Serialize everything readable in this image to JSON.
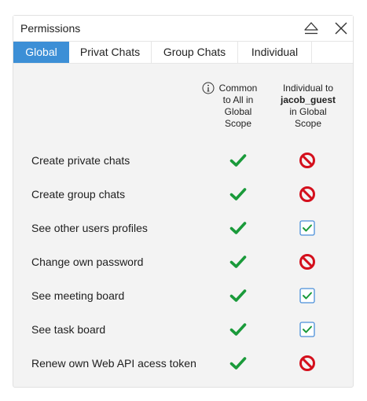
{
  "window": {
    "title": "Permissions"
  },
  "icons": {
    "eject": "eject-icon",
    "close": "close-icon",
    "info": "info-icon"
  },
  "tabs": [
    {
      "label": "Global",
      "active": true
    },
    {
      "label": "Privat Chats",
      "active": false
    },
    {
      "label": "Group Chats",
      "active": false
    },
    {
      "label": "Individual",
      "active": false
    }
  ],
  "columns": {
    "common": {
      "lines": [
        "Common",
        "to All in",
        "Global",
        "Scope"
      ]
    },
    "individual": {
      "line1": "Individual to",
      "user": "jacob_guest",
      "line3": "in Global",
      "line4": "Scope"
    }
  },
  "permissions": [
    {
      "label": "Create private chats",
      "common": "allowed",
      "individual": "denied"
    },
    {
      "label": "Create group chats",
      "common": "allowed",
      "individual": "denied"
    },
    {
      "label": "See other users profiles",
      "common": "allowed",
      "individual": "checked"
    },
    {
      "label": "Change own password",
      "common": "allowed",
      "individual": "denied"
    },
    {
      "label": "See meeting board",
      "common": "allowed",
      "individual": "checked"
    },
    {
      "label": "See task board",
      "common": "allowed",
      "individual": "checked"
    },
    {
      "label": "Renew own Web API acess token",
      "common": "allowed",
      "individual": "denied"
    }
  ],
  "colors": {
    "accent": "#3c8fd6",
    "allowed": "#1a9a3a",
    "denied": "#d40f1c",
    "checkbox_border": "#4a8fd9"
  }
}
